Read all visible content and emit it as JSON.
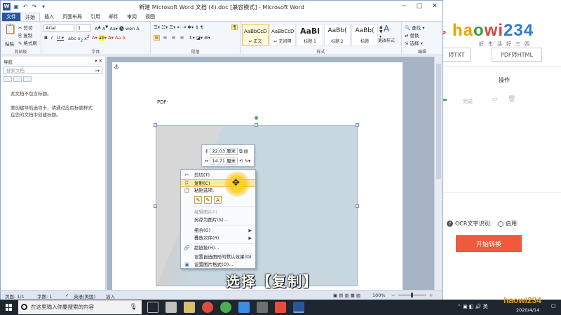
{
  "window": {
    "title": "新建 Microsoft Word 文档 (4).doc [兼容模式] - Microsoft Word",
    "logo_letter": "W",
    "quick_access": [
      "save-icon",
      "undo-icon",
      "redo-icon"
    ],
    "controls": [
      "−",
      "□",
      "✕"
    ]
  },
  "tabs": [
    {
      "label": "文件",
      "kind": "file"
    },
    {
      "label": "开始",
      "kind": "active"
    },
    {
      "label": "插入",
      "kind": "normal"
    },
    {
      "label": "页面布局",
      "kind": "normal"
    },
    {
      "label": "引用",
      "kind": "normal"
    },
    {
      "label": "邮件",
      "kind": "normal"
    },
    {
      "label": "审阅",
      "kind": "normal"
    },
    {
      "label": "视图",
      "kind": "normal"
    }
  ],
  "ribbon": {
    "clipboard": {
      "paste": "粘贴",
      "cut": "剪切",
      "copy": "复制",
      "format_painter": "格式刷",
      "label": "剪贴板"
    },
    "font": {
      "name": "Arial",
      "size": "1",
      "label": "字体"
    },
    "paragraph": {
      "label": "段落"
    },
    "styles": {
      "label": "样式",
      "tiles": [
        {
          "sample": "AaBbCcDd",
          "name": "↵ 正文",
          "size": "small"
        },
        {
          "sample": "AaBbCcDd",
          "name": "↵ 无间隔",
          "size": "small"
        },
        {
          "sample": "AaBl",
          "name": "标题 1",
          "size": "big"
        },
        {
          "sample": "AaBb(",
          "name": "标题 2",
          "size": "mid"
        },
        {
          "sample": "AaBb(",
          "name": "标题",
          "size": "mid"
        }
      ],
      "change_styles": "更改样式"
    },
    "editing": {
      "find": "查找",
      "replace": "替换",
      "select": "选择",
      "label": "编辑"
    }
  },
  "nav": {
    "title": "导航",
    "search_placeholder": "搜索文档",
    "message1": "此文档不包含标题。",
    "message2": "要创建导航选项卡，请通过应用标题样式在您的文档中创建标题。"
  },
  "document": {
    "text": "PDF-"
  },
  "size_toolbar": {
    "height": "22.03 厘米",
    "width": "14.71 厘米"
  },
  "context_menu": {
    "items": [
      {
        "label": "剪切(T)",
        "icon": "✂",
        "state": "normal"
      },
      {
        "label": "复制(C)",
        "icon": "⎘",
        "state": "highlighted"
      },
      {
        "label": "粘贴选项:",
        "icon": "📋",
        "state": "normal"
      }
    ],
    "paste_options": [
      "✎",
      "✎",
      "A"
    ],
    "items_after": [
      {
        "label": "编辑图片(I)",
        "icon": "",
        "state": "disabled",
        "arrow": false
      },
      {
        "label": "另存为图片(S)...",
        "icon": "",
        "state": "normal",
        "arrow": false
      },
      {
        "label": "组合(G)",
        "icon": "",
        "state": "normal",
        "arrow": true
      },
      {
        "label": "叠放次序(R)",
        "icon": "",
        "state": "normal",
        "arrow": true
      },
      {
        "label": "超链接(H)...",
        "icon": "🔗",
        "state": "normal",
        "arrow": false
      },
      {
        "label": "设置自选图形的默认效果(D)",
        "icon": "",
        "state": "normal",
        "arrow": false
      },
      {
        "label": "设置图片格式(O)...",
        "icon": "▣",
        "state": "normal",
        "arrow": false
      }
    ]
  },
  "subtitle": "选择【复制】",
  "statusbar": {
    "page": "页面: 1/1",
    "words": "字数: 1",
    "language": "英语(美国)",
    "mode": "插入",
    "zoom": "100%"
  },
  "bgapp": {
    "brand": [
      "ha",
      "o",
      "wi",
      "234"
    ],
    "slogan": "好生活好三四",
    "tag": "IP",
    "btn_txt": "转TXT",
    "btn_html": "PDF转HTML",
    "col_op": "操作",
    "status": "完成",
    "ocr_label": "OCR文字识别:",
    "ocr_enable": "启用",
    "start": "开始转换"
  },
  "taskbar": {
    "search_placeholder": "在这里输入你要搜索的内容",
    "date": "2020/4/14",
    "watermark": "haowi234",
    "app_colors": [
      "#c0c0c0",
      "#d9c06a",
      "#e24a3b",
      "#4caf50",
      "#3a8ee6",
      "#6f6f6f",
      "#e84d3b",
      "#2b579a"
    ]
  },
  "colors": {
    "word_blue": "#2b579a",
    "highlight": "#fde9a6",
    "start_button": "#ee5a3c"
  }
}
